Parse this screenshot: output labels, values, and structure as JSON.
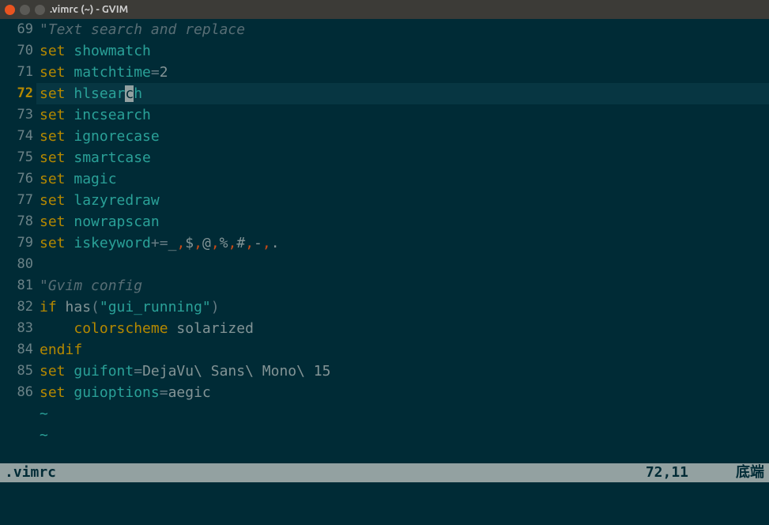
{
  "window": {
    "title": ".vimrc (~) - GVIM"
  },
  "gutter": {
    "start": 69,
    "end": 86,
    "current": 72
  },
  "lines": [
    {
      "n": 69,
      "tokens": [
        {
          "t": "\"Text search and replace",
          "c": "c-comment"
        }
      ]
    },
    {
      "n": 70,
      "tokens": [
        {
          "t": "set ",
          "c": "c-keyword"
        },
        {
          "t": "showmatch",
          "c": "c-option"
        }
      ]
    },
    {
      "n": 71,
      "tokens": [
        {
          "t": "set ",
          "c": "c-keyword"
        },
        {
          "t": "matchtime",
          "c": "c-option"
        },
        {
          "t": "=",
          "c": "c-operator"
        },
        {
          "t": "2",
          "c": "c-value"
        }
      ]
    },
    {
      "n": 72,
      "tokens": [
        {
          "t": "set ",
          "c": "c-keyword"
        },
        {
          "t": "hlsear",
          "c": "c-option"
        },
        {
          "t": "c",
          "c": "cursor-block"
        },
        {
          "t": "h",
          "c": "c-option"
        }
      ],
      "current": true
    },
    {
      "n": 73,
      "tokens": [
        {
          "t": "set ",
          "c": "c-keyword"
        },
        {
          "t": "incsearch",
          "c": "c-option"
        }
      ]
    },
    {
      "n": 74,
      "tokens": [
        {
          "t": "set ",
          "c": "c-keyword"
        },
        {
          "t": "ignorecase",
          "c": "c-option"
        }
      ]
    },
    {
      "n": 75,
      "tokens": [
        {
          "t": "set ",
          "c": "c-keyword"
        },
        {
          "t": "smartcase",
          "c": "c-option"
        }
      ]
    },
    {
      "n": 76,
      "tokens": [
        {
          "t": "set ",
          "c": "c-keyword"
        },
        {
          "t": "magic",
          "c": "c-option"
        }
      ]
    },
    {
      "n": 77,
      "tokens": [
        {
          "t": "set ",
          "c": "c-keyword"
        },
        {
          "t": "lazyredraw",
          "c": "c-option"
        }
      ]
    },
    {
      "n": 78,
      "tokens": [
        {
          "t": "set ",
          "c": "c-keyword"
        },
        {
          "t": "nowrapscan",
          "c": "c-option"
        }
      ]
    },
    {
      "n": 79,
      "tokens": [
        {
          "t": "set ",
          "c": "c-keyword"
        },
        {
          "t": "iskeyword",
          "c": "c-option"
        },
        {
          "t": "+=",
          "c": "c-operator"
        },
        {
          "t": "_",
          "c": "c-value"
        },
        {
          "t": ",",
          "c": "c-sep"
        },
        {
          "t": "$",
          "c": "c-value"
        },
        {
          "t": ",",
          "c": "c-sep"
        },
        {
          "t": "@",
          "c": "c-value"
        },
        {
          "t": ",",
          "c": "c-sep"
        },
        {
          "t": "%",
          "c": "c-value"
        },
        {
          "t": ",",
          "c": "c-sep"
        },
        {
          "t": "#",
          "c": "c-value"
        },
        {
          "t": ",",
          "c": "c-sep"
        },
        {
          "t": "-",
          "c": "c-value"
        },
        {
          "t": ",",
          "c": "c-sep"
        },
        {
          "t": ".",
          "c": "c-value"
        }
      ]
    },
    {
      "n": 80,
      "tokens": []
    },
    {
      "n": 81,
      "tokens": [
        {
          "t": "\"Gvim config",
          "c": "c-comment"
        }
      ]
    },
    {
      "n": 82,
      "tokens": [
        {
          "t": "if ",
          "c": "c-keyword"
        },
        {
          "t": "has",
          "c": "c-func"
        },
        {
          "t": "(",
          "c": "c-operator"
        },
        {
          "t": "\"gui_running\"",
          "c": "c-string"
        },
        {
          "t": ")",
          "c": "c-operator"
        }
      ]
    },
    {
      "n": 83,
      "tokens": [
        {
          "t": "    ",
          "c": ""
        },
        {
          "t": "colorscheme ",
          "c": "c-keyword"
        },
        {
          "t": "solarized",
          "c": "c-value"
        }
      ]
    },
    {
      "n": 84,
      "tokens": [
        {
          "t": "endif",
          "c": "c-keyword"
        }
      ]
    },
    {
      "n": 85,
      "tokens": [
        {
          "t": "set ",
          "c": "c-keyword"
        },
        {
          "t": "guifont",
          "c": "c-option"
        },
        {
          "t": "=",
          "c": "c-operator"
        },
        {
          "t": "DejaVu\\ Sans\\ Mono\\ 15",
          "c": "c-value"
        }
      ]
    },
    {
      "n": 86,
      "tokens": [
        {
          "t": "set ",
          "c": "c-keyword"
        },
        {
          "t": "guioptions",
          "c": "c-option"
        },
        {
          "t": "=",
          "c": "c-operator"
        },
        {
          "t": "aegic",
          "c": "c-value"
        }
      ]
    }
  ],
  "tilde_count": 2,
  "status": {
    "filename": ".vimrc",
    "pos": "72,11",
    "scroll": "底端"
  }
}
